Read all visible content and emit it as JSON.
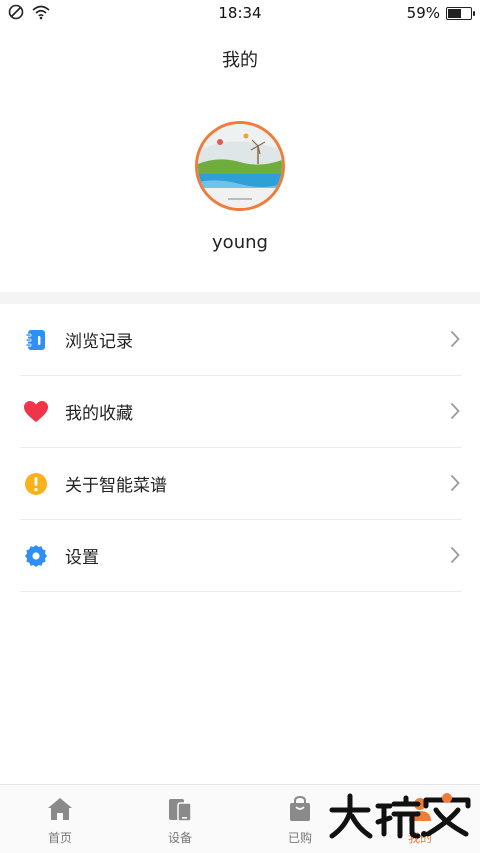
{
  "status_bar": {
    "time": "18:34",
    "battery_percent": "59%",
    "battery_level": 0.59,
    "icons": [
      "do-not-disturb-icon",
      "wifi-icon",
      "battery-icon"
    ]
  },
  "header": {
    "title": "我的"
  },
  "profile": {
    "username": "young"
  },
  "menu": {
    "items": [
      {
        "label": "浏览记录",
        "icon": "history-notebook-icon",
        "color": "#2f8ff5"
      },
      {
        "label": "我的收藏",
        "icon": "heart-icon",
        "color": "#f0344a"
      },
      {
        "label": "关于智能菜谱",
        "icon": "info-exclamation-icon",
        "color": "#f9b21c"
      },
      {
        "label": "设置",
        "icon": "gear-icon",
        "color": "#2f8ff5"
      }
    ]
  },
  "tabbar": {
    "tabs": [
      {
        "label": "首页",
        "icon": "home-icon",
        "active": false
      },
      {
        "label": "设备",
        "icon": "devices-icon",
        "active": false
      },
      {
        "label": "已购",
        "icon": "shopping-bag-icon",
        "active": false
      },
      {
        "label": "我的",
        "icon": "person-icon",
        "active": true
      }
    ]
  },
  "colors": {
    "accent": "#f07c3a",
    "icon_gray": "#8a8a8a"
  }
}
